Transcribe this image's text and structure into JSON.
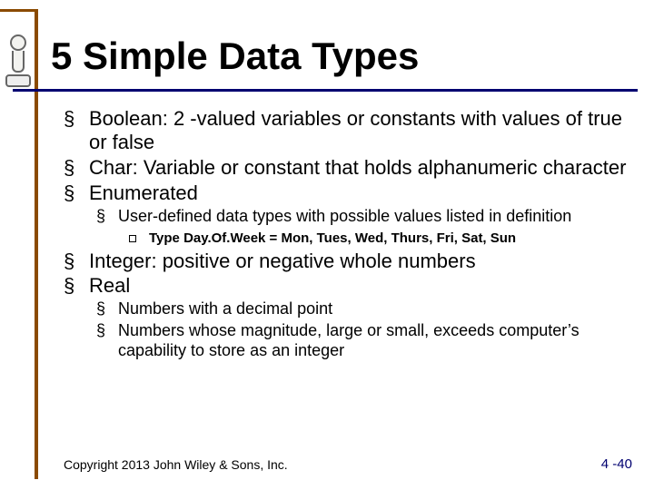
{
  "title": "5 Simple Data Types",
  "bullets": {
    "boolean": "Boolean: 2 -valued variables or constants with values of true or false",
    "char": "Char: Variable or constant that holds alphanumeric character",
    "enumerated": "Enumerated",
    "enumerated_sub": "User-defined data types with possible values listed in definition",
    "enumerated_example": "Type Day.Of.Week = Mon, Tues, Wed, Thurs, Fri, Sat, Sun",
    "integer": "Integer: positive or negative whole numbers",
    "real": "Real",
    "real_sub1": "Numbers with a decimal point",
    "real_sub2": "Numbers whose magnitude, large or small, exceeds computer’s capability to store as an integer"
  },
  "footer": {
    "copyright": "Copyright 2013 John Wiley & Sons, Inc.",
    "page": "4 -40"
  }
}
